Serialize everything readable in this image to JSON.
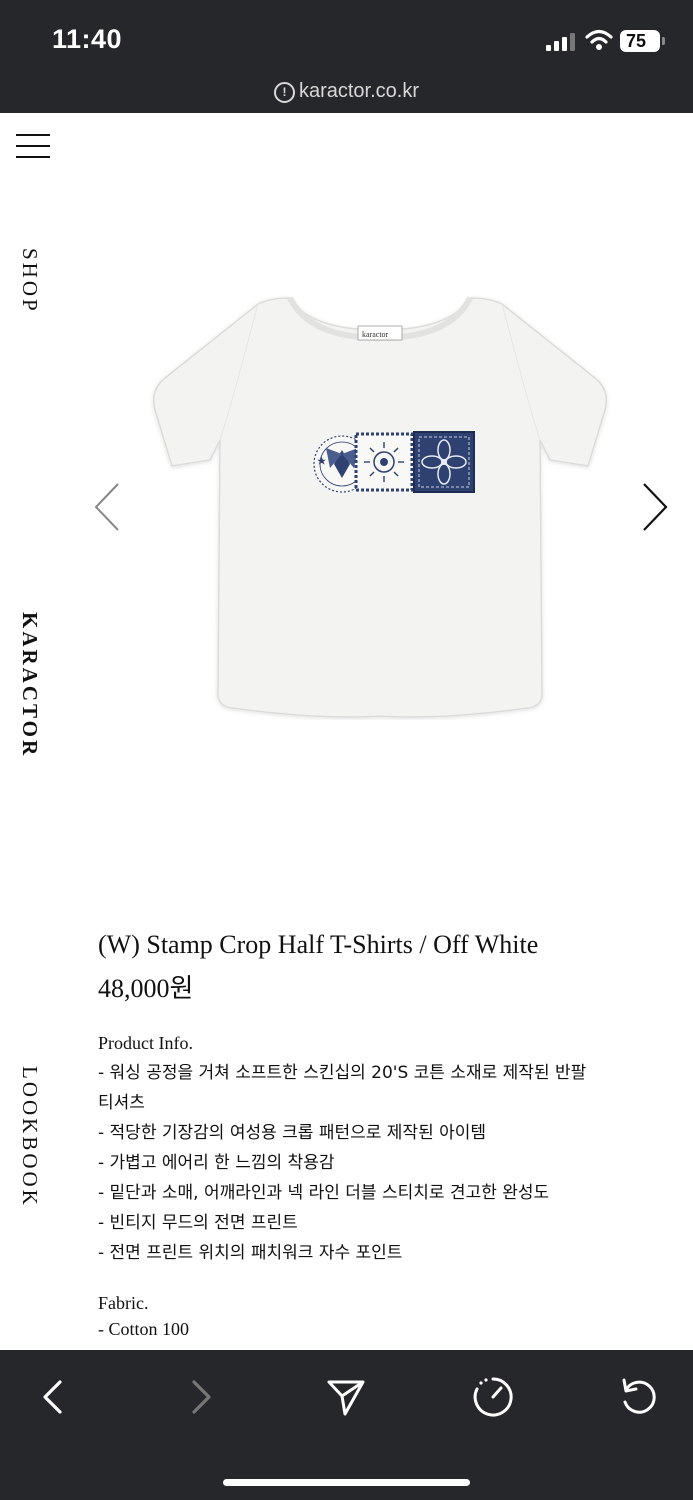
{
  "status_bar": {
    "time": "11:40",
    "battery": "75"
  },
  "browser": {
    "url": "karactor.co.kr"
  },
  "side_nav": {
    "items": [
      "SHOP",
      "KARACTOR",
      "LOOKBOOK"
    ]
  },
  "product": {
    "title": "(W) Stamp Crop Half T-Shirts / Off White",
    "price": "48,000원",
    "label_tag": "karactor",
    "info_heading": "Product Info.",
    "info_lines": [
      "- 워싱 공정을 거쳐 소프트한 스킨십의 20'S 코튼 소재로 제작된 반팔",
      "티셔츠",
      "- 적당한 기장감의 여성용 크롭 패턴으로 제작된 아이템",
      "- 가볍고 에어리 한 느낌의 착용감",
      "- 밑단과 소매, 어깨라인과 넥 라인 더블 스티치로 견고한 완성도",
      "- 빈티지 무드의 전면 프린트",
      "- 전면 프린트 위치의 패치워크 자수 포인트"
    ],
    "fabric_heading": "Fabric.",
    "fabric_value": "- Cotton 100"
  },
  "icons": {
    "image_prev": "chevron-left-icon",
    "image_next": "chevron-right-icon",
    "toolbar": [
      "back-icon",
      "forward-icon",
      "share-icon",
      "speed-icon",
      "reload-icon"
    ]
  },
  "colors": {
    "chrome_bg": "#26272a",
    "print_navy": "#2f4170"
  }
}
